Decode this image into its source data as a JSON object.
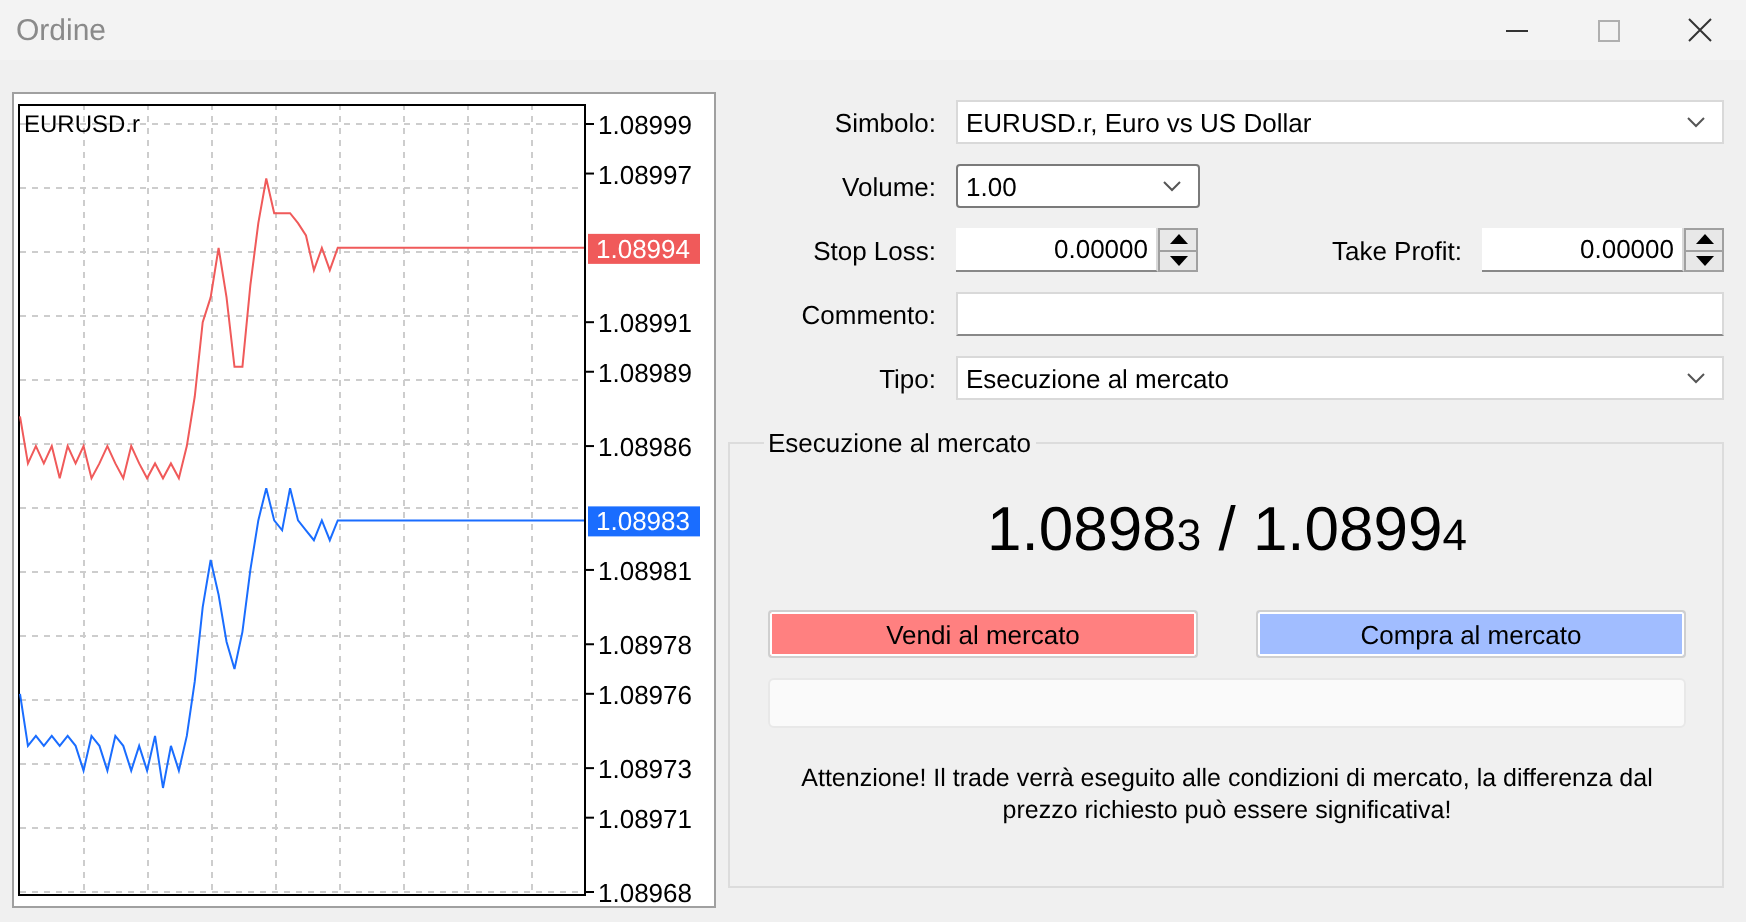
{
  "window": {
    "title": "Ordine",
    "controls": [
      {
        "kind": "minimize",
        "disabled": false
      },
      {
        "kind": "maximize",
        "disabled": true
      },
      {
        "kind": "close",
        "disabled": false
      }
    ]
  },
  "chart": {
    "symbol": "EURUSD.r",
    "chart_data": {
      "type": "line",
      "grid": true,
      "categories": [
        null,
        null,
        null,
        null,
        null,
        null,
        null,
        null,
        null,
        null,
        null,
        null,
        null,
        null,
        null,
        null,
        null,
        null,
        null,
        null,
        null,
        null,
        null,
        null,
        null,
        null,
        null,
        null,
        null,
        null,
        null,
        null,
        null,
        null,
        null,
        null,
        null,
        null,
        null,
        null,
        null,
        null,
        null,
        null,
        null,
        null,
        null,
        null,
        null,
        null,
        null,
        null,
        null,
        null,
        null,
        null,
        null,
        null,
        null,
        null,
        null,
        null,
        null,
        null,
        null,
        null,
        null,
        null,
        null,
        null,
        null,
        null
      ],
      "ylim": [
        1.08968,
        1.08999
      ],
      "series": [
        {
          "color": "#f05a5a",
          "values": [
            1.089872,
            1.089853,
            1.08986,
            1.089853,
            1.08986,
            1.089847,
            1.08986,
            1.089853,
            1.08986,
            1.089847,
            1.089853,
            1.08986,
            1.089853,
            1.089847,
            1.08986,
            1.089853,
            1.089847,
            1.089853,
            1.089847,
            1.089853,
            1.089847,
            1.08986,
            1.08988,
            1.08991,
            1.08992,
            1.08994,
            1.08992,
            1.089892,
            1.089892,
            1.089925,
            1.08995,
            1.089968,
            1.089954,
            1.089954,
            1.089954,
            1.08995,
            1.089945,
            1.089931,
            1.08994,
            1.089931,
            1.08994,
            1.08994,
            1.08994,
            1.08994,
            1.08994,
            1.08994,
            1.08994,
            1.08994,
            1.08994,
            1.08994,
            1.08994,
            1.08994,
            1.08994,
            1.08994,
            1.08994,
            1.08994,
            1.08994,
            1.08994,
            1.08994,
            1.08994,
            1.08994,
            1.08994,
            1.08994,
            1.08994,
            1.08994,
            1.08994,
            1.08994,
            1.08994,
            1.08994,
            1.08994,
            1.08994,
            1.08994
          ]
        },
        {
          "color": "#1a6dff",
          "values": [
            1.08976,
            1.089739,
            1.089743,
            1.089739,
            1.089743,
            1.089739,
            1.089743,
            1.089739,
            1.089729,
            1.089743,
            1.089739,
            1.089729,
            1.089743,
            1.089739,
            1.089729,
            1.089739,
            1.089729,
            1.089743,
            1.089722,
            1.089739,
            1.089729,
            1.089743,
            1.089765,
            1.089795,
            1.089814,
            1.0898,
            1.089781,
            1.08977,
            1.089785,
            1.08981,
            1.08983,
            1.089843,
            1.08983,
            1.089826,
            1.089843,
            1.08983,
            1.089826,
            1.089822,
            1.08983,
            1.089822,
            1.08983,
            1.08983,
            1.08983,
            1.08983,
            1.08983,
            1.08983,
            1.08983,
            1.08983,
            1.08983,
            1.08983,
            1.08983,
            1.08983,
            1.08983,
            1.08983,
            1.08983,
            1.08983,
            1.08983,
            1.08983,
            1.08983,
            1.08983,
            1.08983,
            1.08983,
            1.08983,
            1.08983,
            1.08983,
            1.08983,
            1.08983,
            1.08983,
            1.08983,
            1.08983,
            1.08983,
            1.08983
          ]
        }
      ],
      "yticks": [
        {
          "value": 1.08999,
          "label": "1.08999"
        },
        {
          "value": 1.08997,
          "label": "1.08997"
        },
        {
          "value": 1.08991,
          "label": "1.08991"
        },
        {
          "value": 1.08989,
          "label": "1.08989"
        },
        {
          "value": 1.08986,
          "label": "1.08986"
        },
        {
          "value": 1.08981,
          "label": "1.08981"
        },
        {
          "value": 1.08978,
          "label": "1.08978"
        },
        {
          "value": 1.08976,
          "label": "1.08976"
        },
        {
          "value": 1.08973,
          "label": "1.08973"
        },
        {
          "value": 1.08971,
          "label": "1.08971"
        },
        {
          "value": 1.08968,
          "label": "1.08968"
        }
      ]
    },
    "price_tags": [
      {
        "text": "1.08994",
        "color": "#f05a5a"
      },
      {
        "text": "1.08983",
        "color": "#1a6dff"
      }
    ]
  },
  "form": [
    {
      "kind": "select",
      "label": "Simbolo:",
      "value": "EURUSD.r, Euro vs US Dollar"
    },
    {
      "kind": "combo",
      "label": "Volume:",
      "value": "1.00"
    },
    {
      "kind": "spins",
      "fields": [
        {
          "label": "Stop Loss:",
          "value": "0.00000"
        },
        {
          "label": "Take Profit:",
          "value": "0.00000"
        }
      ]
    },
    {
      "kind": "text",
      "label": "Commento:"
    },
    {
      "kind": "select",
      "label": "Tipo:",
      "value": "Esecuzione al mercato"
    }
  ],
  "execution": {
    "title": "Esecuzione al mercato",
    "bid": {
      "main": "1.0898",
      "pip": "3"
    },
    "separator": "/",
    "ask": {
      "main": "1.0899",
      "pip": "4"
    },
    "buttons": [
      {
        "kind": "sell",
        "label": "Vendi al mercato"
      },
      {
        "kind": "buy",
        "label": "Compra al mercato"
      }
    ],
    "warning": "Attenzione! Il trade verrà eseguito alle condizioni di mercato, la differenza dal prezzo richiesto può essere significativa!"
  }
}
